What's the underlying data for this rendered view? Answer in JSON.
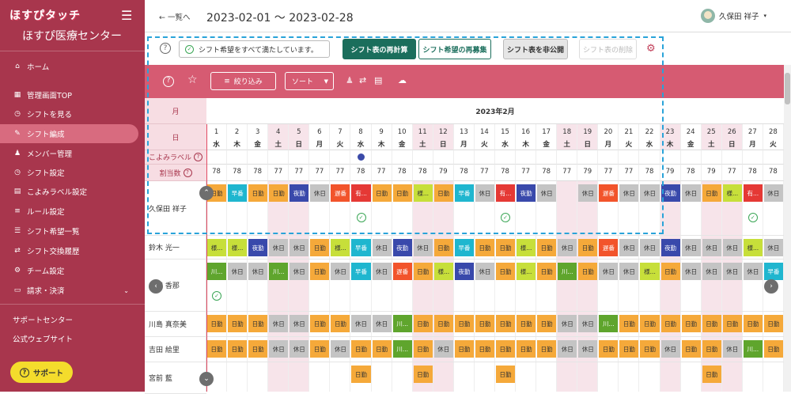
{
  "app": {
    "logo": "ほすぴタッチ",
    "org": "ほすぴ医療センター"
  },
  "sidebar": {
    "items": [
      {
        "label": "ホーム",
        "icon": "home-icon",
        "glyph": "⌂"
      },
      {
        "label": "管理画面TOP",
        "icon": "dashboard-icon",
        "glyph": "▦"
      },
      {
        "label": "シフトを見る",
        "icon": "clock-icon",
        "glyph": "◷"
      },
      {
        "label": "シフト編成",
        "icon": "wrench-icon",
        "glyph": "✎"
      },
      {
        "label": "メンバー管理",
        "icon": "people-icon",
        "glyph": "♟"
      },
      {
        "label": "シフト設定",
        "icon": "clock-settings-icon",
        "glyph": "◷"
      },
      {
        "label": "こよみラベル設定",
        "icon": "calendar-icon",
        "glyph": "▤"
      },
      {
        "label": "ルール設定",
        "icon": "rule-icon",
        "glyph": "≡"
      },
      {
        "label": "シフト希望一覧",
        "icon": "list-icon",
        "glyph": "☰"
      },
      {
        "label": "シフト交換履歴",
        "icon": "exchange-icon",
        "glyph": "⇄"
      },
      {
        "label": "チーム設定",
        "icon": "gear-icon",
        "glyph": "⚙"
      },
      {
        "label": "請求・決済",
        "icon": "card-icon",
        "glyph": "▭"
      }
    ],
    "active_index": 3,
    "footer": [
      "サポートセンター",
      "公式ウェブサイト"
    ],
    "support_label": "サポート"
  },
  "topbar": {
    "back_label": "← 一覧へ",
    "date_range": "2023-02-01 〜 2023-02-28",
    "user_name": "久保田 祥子",
    "user_caret": "▾"
  },
  "controls": {
    "status": "シフト希望をすべて満たしています。",
    "recalc": "シフト表の再計算",
    "recollect": "シフト希望の再募集",
    "unpublish": "シフト表を非公開",
    "delete": "シフト表の削除"
  },
  "toolbar": {
    "filter": "絞り込み",
    "sort": "ソート"
  },
  "table": {
    "month_header": "月",
    "day_header": "日",
    "label_header": "こよみラベル",
    "count_header": "割当数",
    "month_title": "2023年2月",
    "days": [
      "1",
      "2",
      "3",
      "4",
      "5",
      "6",
      "7",
      "8",
      "9",
      "10",
      "11",
      "12",
      "13",
      "14",
      "15",
      "16",
      "17",
      "18",
      "19",
      "20",
      "21",
      "22",
      "23",
      "24",
      "25",
      "26",
      "27",
      "28"
    ],
    "weekdays": [
      "水",
      "木",
      "金",
      "土",
      "日",
      "月",
      "火",
      "水",
      "木",
      "金",
      "土",
      "日",
      "月",
      "火",
      "水",
      "木",
      "金",
      "土",
      "日",
      "月",
      "火",
      "水",
      "木",
      "金",
      "土",
      "日",
      "月",
      "火"
    ],
    "weekend_idx": [
      3,
      4,
      10,
      11,
      17,
      18,
      22,
      24,
      25
    ],
    "label_dot_day_index": 7,
    "counts": [
      "78",
      "78",
      "78",
      "77",
      "77",
      "77",
      "77",
      "78",
      "77",
      "78",
      "78",
      "79",
      "78",
      "77",
      "78",
      "77",
      "78",
      "77",
      "79",
      "77",
      "77",
      "78",
      "79",
      "78",
      "79",
      "77",
      "78",
      "78"
    ],
    "staff": [
      {
        "name": "久保田 祥子",
        "shifts": [
          "日勤",
          "早番",
          "日勤",
          "日勤",
          "夜勤",
          "休日",
          "遅番",
          "有...",
          "日勤",
          "日勤",
          "様...",
          "日勤",
          "早番",
          "休日",
          "有...",
          "夜勤",
          "休日",
          "",
          "休日",
          "遅番",
          "休日",
          "休日",
          "夜勤",
          "休日",
          "日勤",
          "様...",
          "有...",
          "休日"
        ],
        "checks": [
          7,
          14,
          26
        ]
      },
      {
        "name": "鈴木 光一",
        "shifts": [
          "様...",
          "様...",
          "夜勤",
          "休日",
          "休日",
          "日勤",
          "様...",
          "早番",
          "休日",
          "夜勤",
          "休日",
          "日勤",
          "早番",
          "日勤",
          "日勤",
          "様...",
          "日勤",
          "休日",
          "日勤",
          "遅番",
          "休日",
          "休日",
          "夜勤",
          "休日",
          "休日",
          "休日",
          "様...",
          "休日"
        ],
        "checks": []
      },
      {
        "name": "内田 香那",
        "shifts": [
          "川...",
          "休日",
          "休日",
          "川...",
          "休日",
          "日勤",
          "休日",
          "早番",
          "休日",
          "遅番",
          "日勤",
          "様...",
          "夜勤",
          "休日",
          "日勤",
          "様...",
          "日勤",
          "川...",
          "日勤",
          "休日",
          "休日",
          "様...",
          "日勤",
          "休日",
          "休日",
          "休日",
          "休日",
          "早番"
        ],
        "checks": [
          0
        ]
      },
      {
        "name": "川島 真奈美",
        "shifts": [
          "日勤",
          "日勤",
          "日勤",
          "休日",
          "休日",
          "日勤",
          "日勤",
          "休日",
          "休日",
          "川...",
          "日勤",
          "日勤",
          "日勤",
          "日勤",
          "日勤",
          "日勤",
          "日勤",
          "休日",
          "休日",
          "川...",
          "日勤",
          "日勤",
          "日勤",
          "日勤",
          "日勤",
          "日勤",
          "日勤",
          "日勤"
        ],
        "checks": []
      },
      {
        "name": "吉田 絵里",
        "shifts": [
          "日勤",
          "日勤",
          "日勤",
          "休日",
          "休日",
          "日勤",
          "休日",
          "日勤",
          "日勤",
          "川...",
          "日勤",
          "休日",
          "日勤",
          "日勤",
          "日勤",
          "日勤",
          "日勤",
          "休日",
          "休日",
          "日勤",
          "日勤",
          "日勤",
          "休日",
          "日勤",
          "日勤",
          "休日",
          "川...",
          "日勤"
        ],
        "checks": []
      },
      {
        "name": "宮前 藍",
        "shifts": [
          "",
          "",
          "",
          "",
          "",
          "",
          "",
          "日勤",
          "",
          "",
          "日勤",
          "",
          "",
          "",
          "日勤",
          "",
          "",
          "",
          "",
          "",
          "",
          "",
          "",
          "",
          "日勤",
          "",
          "",
          ""
        ],
        "checks": []
      }
    ]
  },
  "shift_colors": {
    "日勤": "#f5a93a",
    "早番": "#1fb6cf",
    "夜勤": "#3949ab",
    "遅番": "#f2542b",
    "休日": "#c4c4c4",
    "有...": "#e53935",
    "様...": "#c7df3a",
    "川...": "#5fa52d"
  },
  "accent": "#a8364d"
}
